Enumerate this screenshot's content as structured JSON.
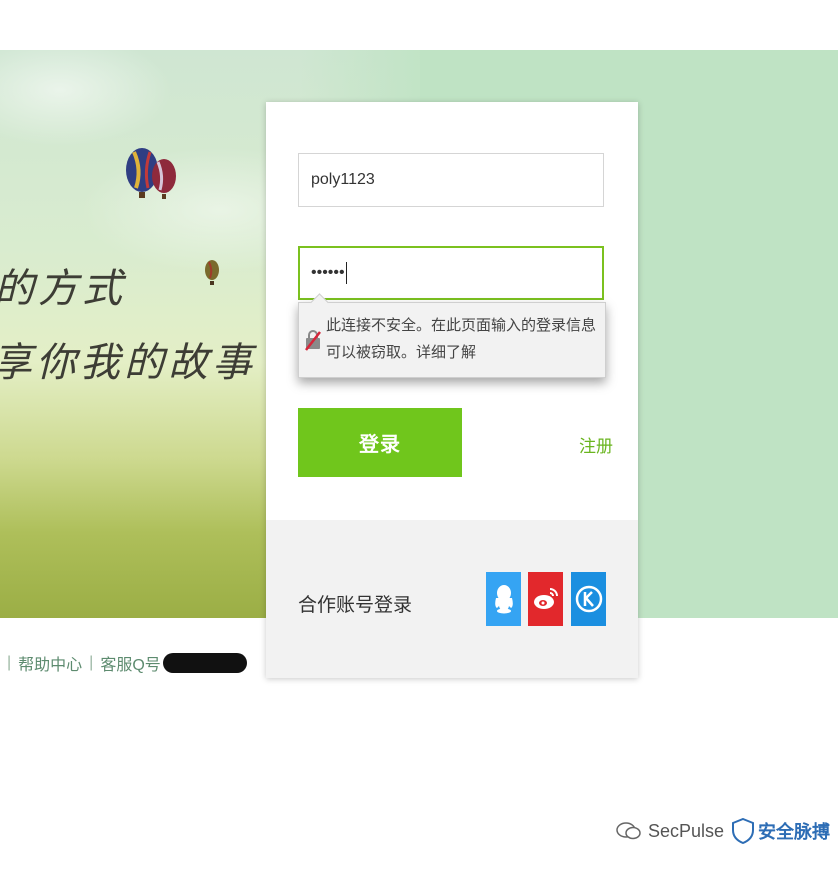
{
  "banner": {
    "slogan_line1": "的方式",
    "slogan_line2": "享你我的故事"
  },
  "footer": {
    "help_center": "帮助中心",
    "customer_service_qq": "客服Q号"
  },
  "login": {
    "username_value": "poly1123",
    "password_value": "••••••",
    "insecure_warning": "此连接不安全。在此页面输入的登录信息可以被窃取。详细了解",
    "login_button": "登录",
    "register_link": "注册"
  },
  "partner": {
    "label": "合作账号登录",
    "providers": [
      "qq-icon",
      "weibo-icon",
      "kaixin-icon"
    ]
  },
  "watermark": {
    "text": "SecPulse",
    "brand": "安全脉搏"
  },
  "colors": {
    "accent_green": "#70c61c",
    "banner_green": "#bfe3c4",
    "qq_blue": "#35a4f3",
    "weibo_red": "#e2282c",
    "kaixin_blue": "#1b8fe0"
  }
}
